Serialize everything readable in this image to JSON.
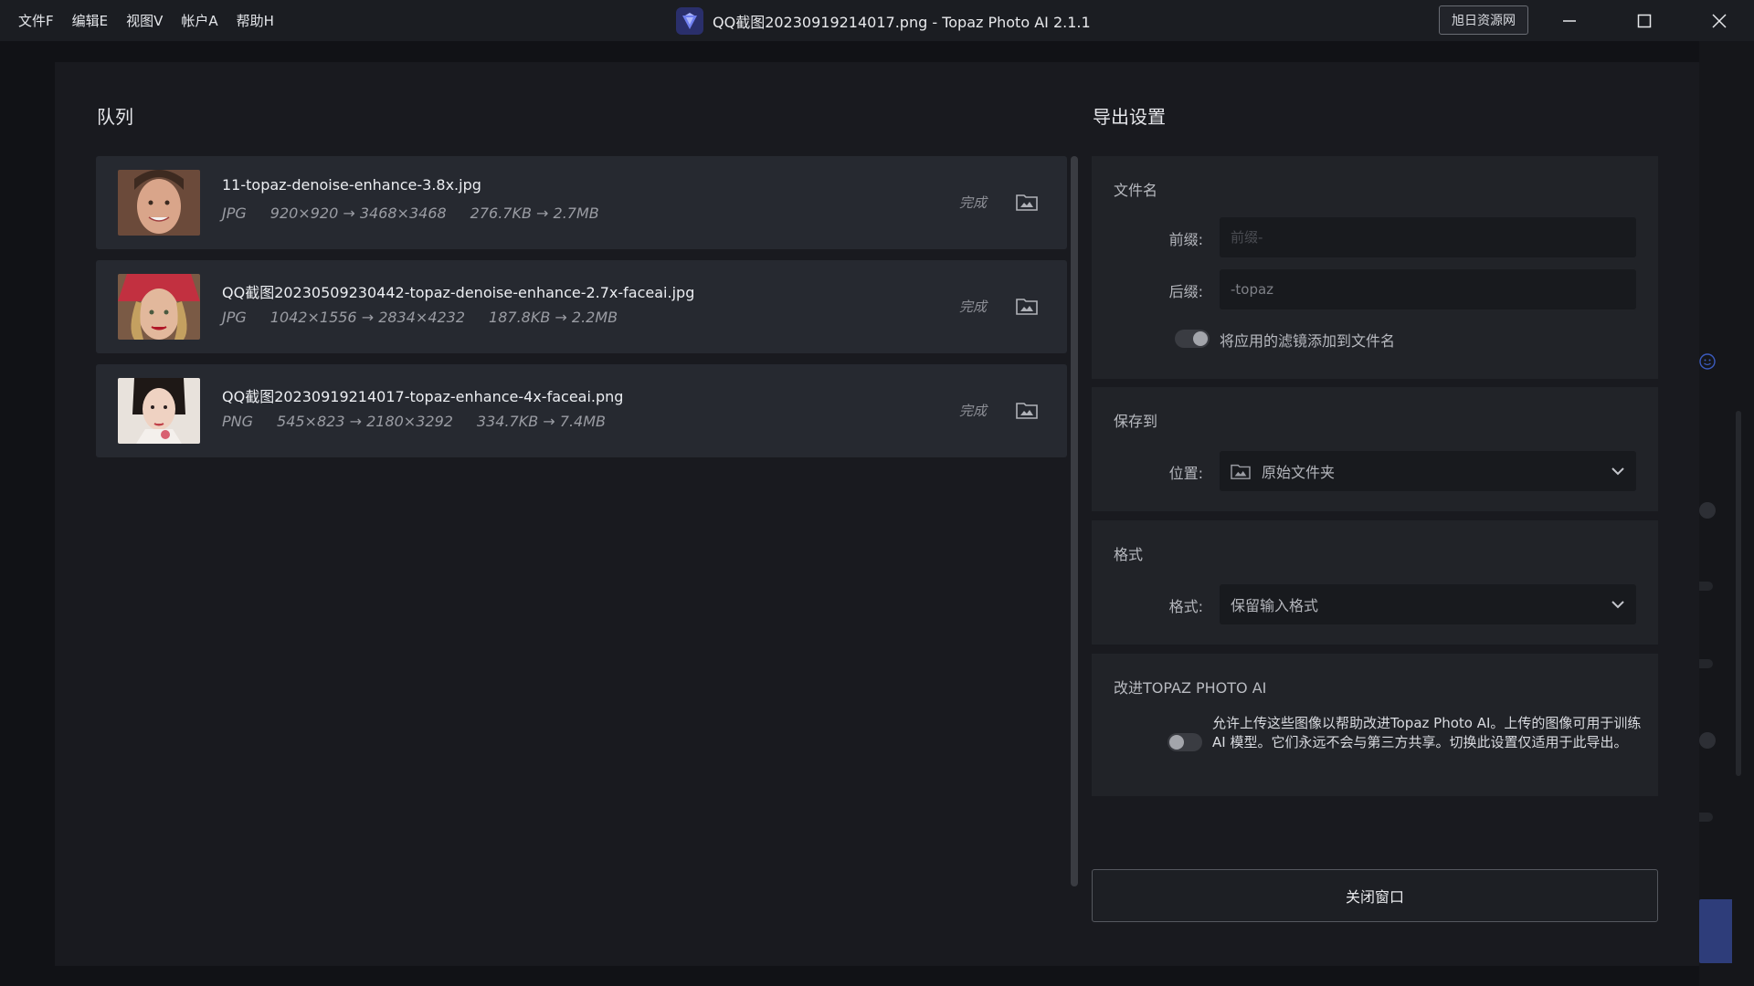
{
  "titlebar": {
    "menu": [
      "文件F",
      "编辑E",
      "视图V",
      "帐户A",
      "帮助H"
    ],
    "window_title": "QQ截图20230919214017.png - Topaz Photo AI 2.1.1",
    "brand_button": "旭日资源网"
  },
  "queue": {
    "title": "队列",
    "items": [
      {
        "name": "11-topaz-denoise-enhance-3.8x.jpg",
        "format": "JPG",
        "dimensions": "920×920 → 3468×3468",
        "size": "276.7KB → 2.7MB",
        "status": "完成"
      },
      {
        "name": "QQ截图20230509230442-topaz-denoise-enhance-2.7x-faceai.jpg",
        "format": "JPG",
        "dimensions": "1042×1556 → 2834×4232",
        "size": "187.8KB → 2.2MB",
        "status": "完成"
      },
      {
        "name": "QQ截图20230919214017-topaz-enhance-4x-faceai.png",
        "format": "PNG",
        "dimensions": "545×823 → 2180×3292",
        "size": "334.7KB → 7.4MB",
        "status": "完成"
      }
    ]
  },
  "export": {
    "title": "导出设置",
    "filename": {
      "title": "文件名",
      "prefix_label": "前缀:",
      "prefix_placeholder": "前缀-",
      "suffix_label": "后缀:",
      "suffix_value": "-topaz",
      "toggle_label": "将应用的滤镜添加到文件名"
    },
    "save_to": {
      "title": "保存到",
      "location_label": "位置:",
      "location_value": "原始文件夹"
    },
    "format": {
      "title": "格式",
      "format_label": "格式:",
      "format_value": "保留输入格式"
    },
    "improve": {
      "title": "改进TOPAZ PHOTO AI",
      "description": "允许上传这些图像以帮助改进Topaz Photo AI。上传的图像可用于训练 AI 模型。它们永远不会与第三方共享。切换此设置仅适用于此导出。"
    },
    "close_button": "关闭窗口"
  },
  "colors": {
    "background": "#111216",
    "titlebar": "#1b1d22",
    "modal": "#191a1f",
    "card": "#212328",
    "queue_item": "#262930",
    "accent": "#2e3d7a"
  }
}
